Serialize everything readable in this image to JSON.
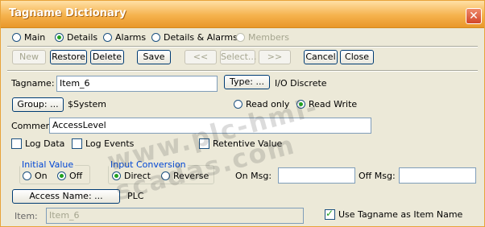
{
  "window": {
    "title": "Tagname Dictionary"
  },
  "view_tabs": [
    {
      "label": "Main",
      "selected": false,
      "disabled": false
    },
    {
      "label": "Details",
      "selected": true,
      "disabled": false
    },
    {
      "label": "Alarms",
      "selected": false,
      "disabled": false
    },
    {
      "label": "Details & Alarms",
      "selected": false,
      "disabled": false
    },
    {
      "label": "Members",
      "selected": false,
      "disabled": true
    }
  ],
  "toolbar": {
    "new": "New",
    "restore": "Restore",
    "delete": "Delete",
    "save": "Save",
    "first": "<<",
    "select": "Select...",
    "last": ">>",
    "cancel": "Cancel",
    "close": "Close"
  },
  "tag": {
    "tagname_label": "Tagname:",
    "tagname_value": "Item_6",
    "type_button": "Type: ...",
    "type_value": "I/O Discrete",
    "group_button": "Group: ...",
    "group_value": "$System",
    "read_only": "Read only",
    "read_write": "Read Write",
    "comment_label": "Comment:",
    "comment_value": "AccessLevel",
    "log_data": "Log Data",
    "log_events": "Log Events",
    "retentive_value": "Retentive Value"
  },
  "details": {
    "initial_value_label": "Initial Value",
    "on": "On",
    "off": "Off",
    "input_conversion_label": "Input Conversion",
    "direct": "Direct",
    "reverse": "Reverse",
    "on_msg_label": "On Msg:",
    "on_msg_value": "",
    "off_msg_label": "Off Msg:",
    "off_msg_value": "",
    "access_name_button": "Access Name: ...",
    "access_name_value": "PLC",
    "item_label": "Item:",
    "item_value": "Item_6",
    "use_tagname_label": "Use Tagname as Item Name",
    "use_tagname_checked": true
  },
  "watermark": "www.plc-hmi-scadas.com",
  "colors": {
    "title_bar": "#f5b24d",
    "accent_green": "#21a121",
    "legend_blue": "#0046d5"
  }
}
